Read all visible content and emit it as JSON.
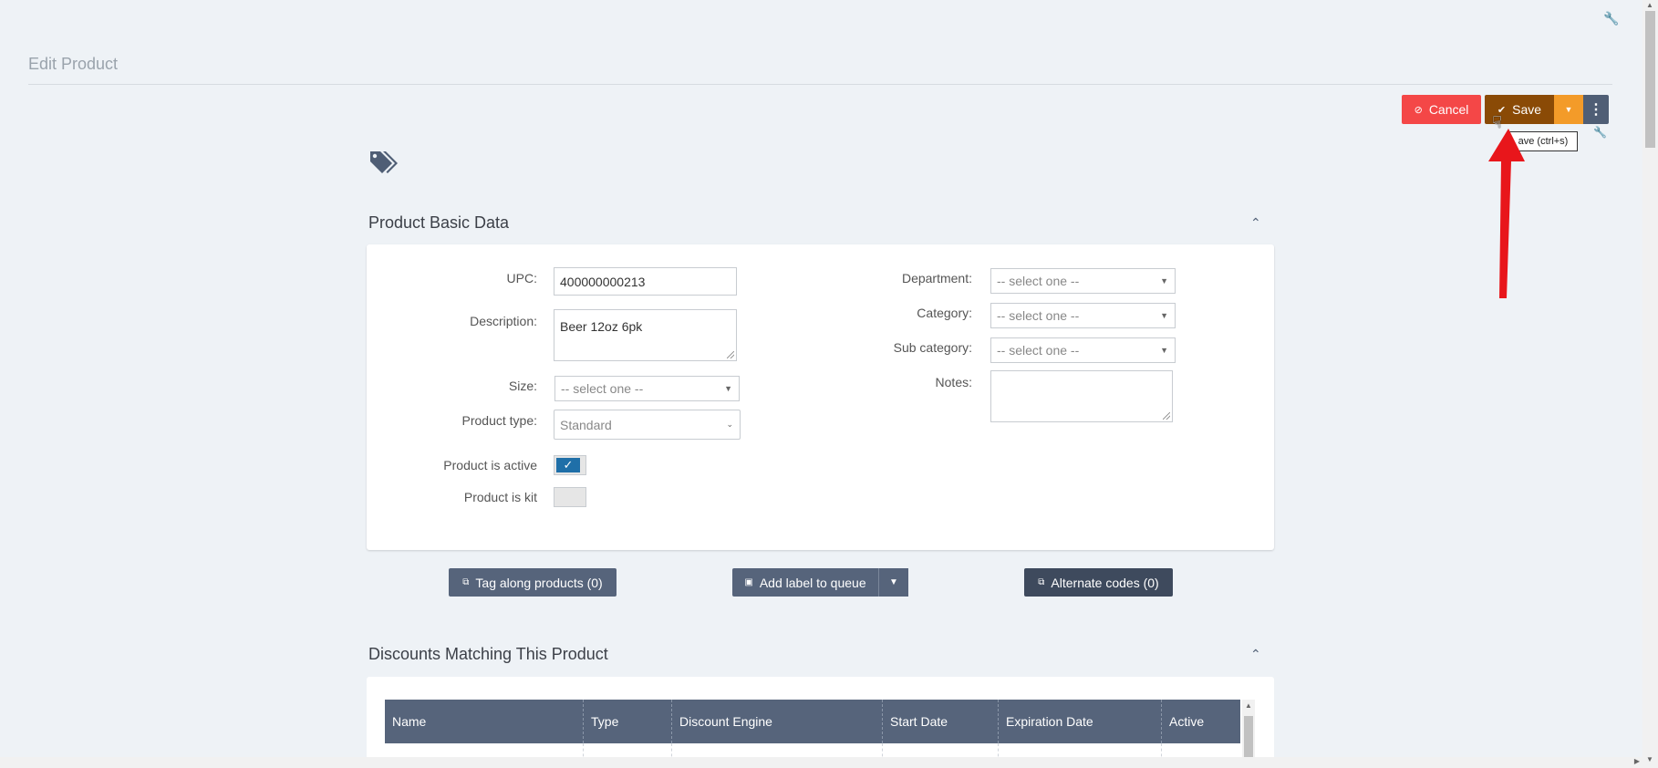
{
  "page": {
    "title": "Edit Product"
  },
  "toolbar": {
    "cancel_label": "Cancel",
    "save_label": "Save",
    "save_tooltip": "ave (ctrl+s)"
  },
  "basic_section": {
    "title": "Product Basic Data"
  },
  "form": {
    "upc": {
      "label": "UPC:",
      "value": "400000000213"
    },
    "description": {
      "label": "Description:",
      "value": "Beer 12oz 6pk"
    },
    "size": {
      "label": "Size:",
      "placeholder": "-- select one --"
    },
    "product_type": {
      "label": "Product type:",
      "value": "Standard"
    },
    "product_active": {
      "label": "Product is active",
      "checked": true
    },
    "product_kit": {
      "label": "Product is kit",
      "checked": false
    },
    "department": {
      "label": "Department:",
      "placeholder": "-- select one --"
    },
    "category": {
      "label": "Category:",
      "placeholder": "-- select one --"
    },
    "subcategory": {
      "label": "Sub category:",
      "placeholder": "-- select one --"
    },
    "notes": {
      "label": "Notes:",
      "value": ""
    }
  },
  "actions": {
    "tag_along": "Tag along products (0)",
    "add_label": "Add label to queue",
    "alternate_codes": "Alternate codes (0)"
  },
  "discounts_section": {
    "title": "Discounts Matching This Product",
    "columns": [
      "Name",
      "Type",
      "Discount Engine",
      "Start Date",
      "Expiration Date",
      "Active"
    ]
  },
  "colors": {
    "cancel": "#f44747",
    "save": "#8a4a06",
    "save_dropdown": "#f39b29",
    "more": "#4f5e75",
    "header": "#56647b",
    "toggle_on": "#1f6fa8"
  },
  "icons": {
    "wrench": "wrench-icon",
    "tags": "tags-icon",
    "chevron_up": "chevron-up-icon",
    "check": "check-icon",
    "cancel": "ban-icon",
    "more": "vertical-dots-icon",
    "external": "external-link-icon",
    "arrow_annotation": "red-arrow-annotation"
  }
}
